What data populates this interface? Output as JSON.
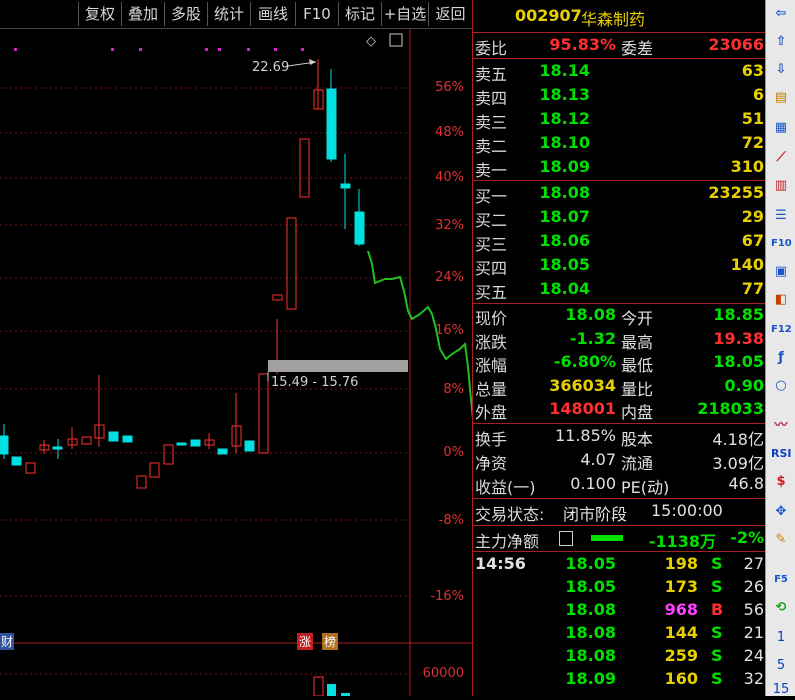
{
  "toolbar": {
    "buttons": [
      "复权",
      "叠加",
      "多股",
      "统计",
      "画线",
      "F10",
      "标记",
      "+自选",
      "返回"
    ]
  },
  "chart": {
    "pct_labels": [
      "56%",
      "48%",
      "40%",
      "32%",
      "24%",
      "16%",
      "8%",
      "0%",
      "-8%",
      "-16%"
    ],
    "high_marker": "22.69",
    "range_label": "15.49 - 15.76",
    "volume_label": "60000",
    "tag_zhang": "涨",
    "tag_bang": "榜",
    "tag_cai": "财"
  },
  "stock": {
    "code": "002907",
    "name": "华森制药"
  },
  "weibi": {
    "label": "委比",
    "value": "95.83%",
    "label2": "委差",
    "value2": "23066"
  },
  "sells": [
    {
      "label": "卖五",
      "price": "18.14",
      "vol": "63"
    },
    {
      "label": "卖四",
      "price": "18.13",
      "vol": "6"
    },
    {
      "label": "卖三",
      "price": "18.12",
      "vol": "51"
    },
    {
      "label": "卖二",
      "price": "18.10",
      "vol": "72"
    },
    {
      "label": "卖一",
      "price": "18.09",
      "vol": "310"
    }
  ],
  "buys": [
    {
      "label": "买一",
      "price": "18.08",
      "vol": "23255"
    },
    {
      "label": "买二",
      "price": "18.07",
      "vol": "29"
    },
    {
      "label": "买三",
      "price": "18.06",
      "vol": "67"
    },
    {
      "label": "买四",
      "price": "18.05",
      "vol": "140"
    },
    {
      "label": "买五",
      "price": "18.04",
      "vol": "77"
    }
  ],
  "stats": [
    {
      "l1": "现价",
      "v1": "18.08",
      "l2": "今开",
      "v2": "18.85"
    },
    {
      "l1": "涨跌",
      "v1": "-1.32",
      "l2": "最高",
      "v2": "19.38"
    },
    {
      "l1": "涨幅",
      "v1": "-6.80%",
      "l2": "最低",
      "v2": "18.05"
    },
    {
      "l1": "总量",
      "v1": "366034",
      "l2": "量比",
      "v2": "0.90"
    },
    {
      "l1": "外盘",
      "v1": "148001",
      "l2": "内盘",
      "v2": "218033"
    }
  ],
  "stats2": [
    {
      "l1": "换手",
      "v1": "11.85%",
      "l2": "股本",
      "v2": "4.18亿"
    },
    {
      "l1": "净资",
      "v1": "4.07",
      "l2": "流通",
      "v2": "3.09亿"
    },
    {
      "l1": "收益(一)",
      "v1": "0.100",
      "l2": "PE(动)",
      "v2": "46.8"
    }
  ],
  "trade_status": {
    "label": "交易状态:",
    "value": "闭市阶段",
    "time": "15:00:00"
  },
  "main_flow": {
    "label": "主力净额",
    "value": "-1138万",
    "pct": "-2%"
  },
  "ticks": [
    {
      "time": "14:56",
      "price": "18.05",
      "vol": "198",
      "side": "S",
      "n": "27"
    },
    {
      "time": "",
      "price": "18.05",
      "vol": "173",
      "side": "S",
      "n": "26"
    },
    {
      "time": "",
      "price": "18.08",
      "vol": "968",
      "side": "B",
      "n": "56"
    },
    {
      "time": "",
      "price": "18.08",
      "vol": "144",
      "side": "S",
      "n": "21"
    },
    {
      "time": "",
      "price": "18.08",
      "vol": "259",
      "side": "S",
      "n": "24"
    },
    {
      "time": "",
      "price": "18.09",
      "vol": "160",
      "side": "S",
      "n": "32"
    }
  ],
  "iconbar": {
    "bottom_nums": [
      "1",
      "5",
      "15"
    ],
    "rsi": "RSI",
    "f10": "F10",
    "f5": "F5"
  },
  "colors": {
    "up": "#ff3030",
    "down": "#00ffff",
    "line": "#20c020",
    "bg": "#000000"
  }
}
